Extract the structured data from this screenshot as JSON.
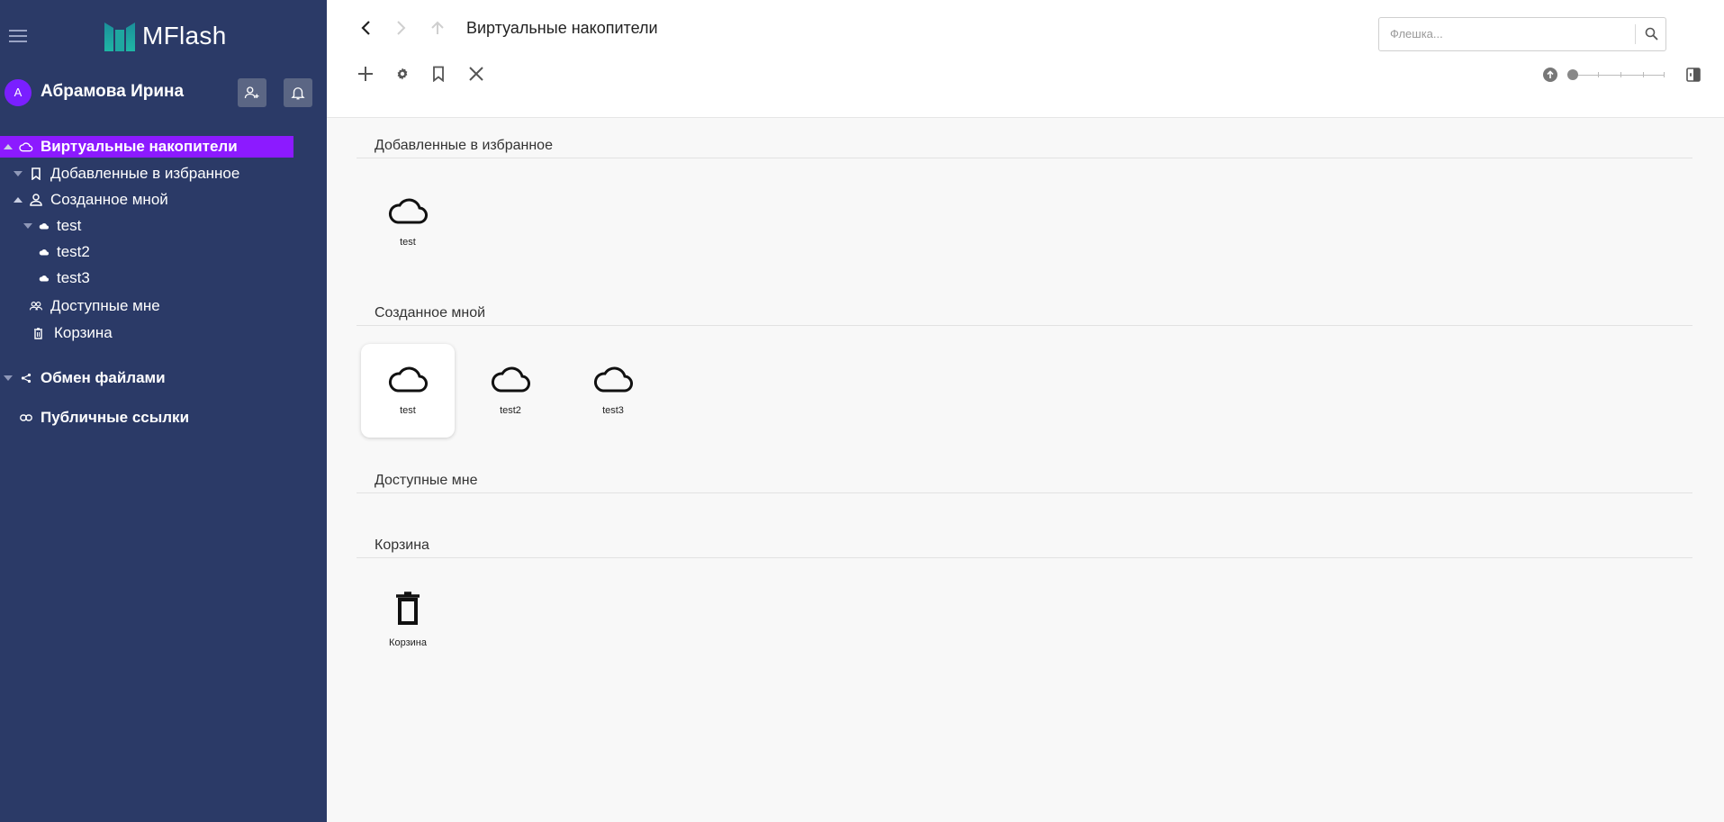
{
  "app": {
    "name": "MFlash",
    "accent": "#8c1aff",
    "sidebar_bg": "#2b3a67"
  },
  "user": {
    "initial": "А",
    "name": "Абрамова Ирина"
  },
  "tree": {
    "virtual": "Виртуальные накопители",
    "favorites": "Добавленные в избранное",
    "created": "Созданное мной",
    "test": "test",
    "test2": "test2",
    "test3": "test3",
    "shared": "Доступные мне",
    "trash": "Корзина",
    "exchange": "Обмен файлами",
    "public_links": "Публичные ссылки"
  },
  "header": {
    "breadcrumb": "Виртуальные накопители",
    "search_placeholder": "Флешка...",
    "search_value": ""
  },
  "sections": {
    "favorites": {
      "title": "Добавленные в избранное",
      "items": [
        "test"
      ]
    },
    "created": {
      "title": "Созданное мной",
      "items": [
        "test",
        "test2",
        "test3"
      ]
    },
    "shared": {
      "title": "Доступные мне",
      "items": []
    },
    "trash": {
      "title": "Корзина",
      "items": [
        "Корзина"
      ]
    }
  }
}
